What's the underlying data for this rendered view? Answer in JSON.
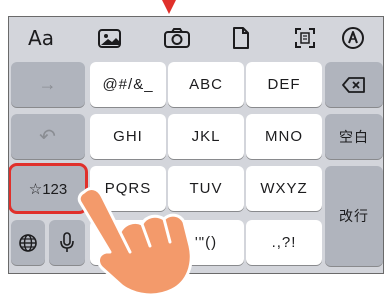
{
  "toolbar": {
    "text_format_label": "Aa",
    "icons": [
      "photo-library-icon",
      "camera-icon",
      "document-icon",
      "scan-text-icon",
      "markup-pen-icon"
    ]
  },
  "keys": {
    "arrow_right": "→",
    "undo": "↶",
    "symbols_toggle": "☆123",
    "globe": "globe-icon",
    "mic": "microphone-icon",
    "row1": [
      "@#/&_",
      "ABC",
      "DEF"
    ],
    "row2": [
      "GHI",
      "JKL",
      "MNO"
    ],
    "row3": [
      "PQRS",
      "TUV",
      "WXYZ"
    ],
    "row4_partial": [
      "'\"()",
      ".,?!"
    ],
    "delete": "delete-icon",
    "space": "空白",
    "return": "改行"
  },
  "colors": {
    "highlight": "#e0302b",
    "keyboard_bg": "#d3d5db",
    "hand": "#f39a6b"
  }
}
